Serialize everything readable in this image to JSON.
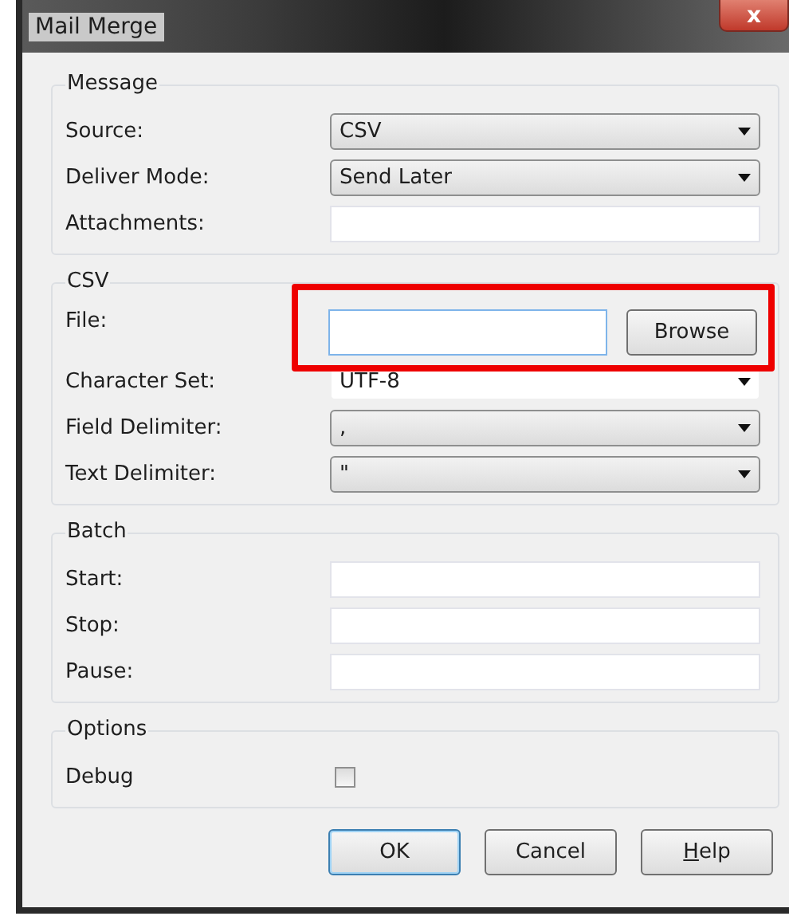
{
  "window": {
    "title": "Mail Merge",
    "close_glyph": "x"
  },
  "groups": [
    {
      "title": "Message",
      "rows": [
        {
          "label": "Source:",
          "kind": "combo",
          "value": "CSV"
        },
        {
          "label": "Deliver Mode:",
          "kind": "combo",
          "value": "Send Later"
        },
        {
          "label": "Attachments:",
          "kind": "text"
        }
      ]
    },
    {
      "title": "CSV",
      "rows": [
        {
          "label": "File:",
          "kind": "file",
          "button": "Browse",
          "highlighted": true
        },
        {
          "label": "Character Set:",
          "kind": "editable-combo",
          "value": "UTF-8"
        },
        {
          "label": "Field Delimiter:",
          "kind": "combo",
          "value": ","
        },
        {
          "label": "Text Delimiter:",
          "kind": "combo",
          "value": "\""
        }
      ]
    },
    {
      "title": "Batch",
      "rows": [
        {
          "label": "Start:",
          "kind": "text"
        },
        {
          "label": "Stop:",
          "kind": "text"
        },
        {
          "label": "Pause:",
          "kind": "text"
        }
      ]
    },
    {
      "title": "Options",
      "rows": [
        {
          "label": "Debug",
          "kind": "checkbox",
          "checked": false
        }
      ]
    }
  ],
  "buttons": [
    {
      "label": "OK",
      "default": true,
      "mnemonic": false
    },
    {
      "label": "Cancel",
      "default": false,
      "mnemonic": false
    },
    {
      "label": "Help",
      "default": false,
      "mnemonic": true
    }
  ]
}
